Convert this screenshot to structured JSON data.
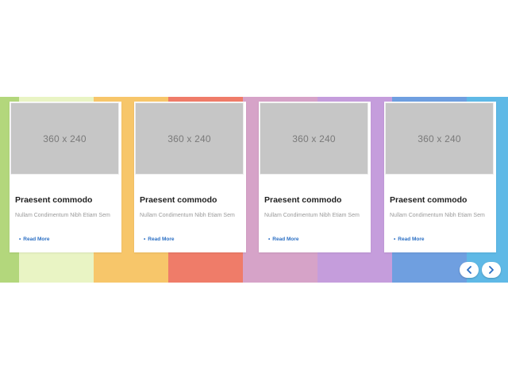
{
  "carousel": {
    "stripes": [
      {
        "color": "#b3d77c",
        "w": 24
      },
      {
        "color": "#e9f4c4",
        "w": 94
      },
      {
        "color": "#f7c66a",
        "w": 94
      },
      {
        "color": "#ef7c69",
        "w": 94
      },
      {
        "color": "#d6a3c8",
        "w": 94
      },
      {
        "color": "#c59ddc",
        "w": 94
      },
      {
        "color": "#6f9fe0",
        "w": 94
      },
      {
        "color": "#5fb9e6",
        "w": 52
      }
    ],
    "cards": [
      {
        "image_label": "360 x 240",
        "title": "Praesent commodo",
        "desc": "Nullam Condimentum Nibh Etiam Sem",
        "link": "Read More"
      },
      {
        "image_label": "360 x 240",
        "title": "Praesent commodo",
        "desc": "Nullam Condimentum Nibh Etiam Sem",
        "link": "Read More"
      },
      {
        "image_label": "360 x 240",
        "title": "Praesent commodo",
        "desc": "Nullam Condimentum Nibh Etiam Sem",
        "link": "Read More"
      },
      {
        "image_label": "360 x 240",
        "title": "Praesent commodo",
        "desc": "Nullam Condimentum Nibh Etiam Sem",
        "link": "Read More"
      }
    ],
    "nav": {
      "prev_icon": "chevron-left-icon",
      "next_icon": "chevron-right-icon",
      "accent": "#2b6fc4"
    }
  }
}
